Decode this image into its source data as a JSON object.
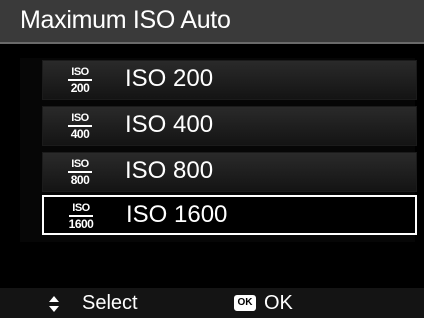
{
  "header": {
    "title": "Maximum ISO Auto"
  },
  "items": [
    {
      "icon_top": "ISO",
      "icon_value": "200",
      "label": "ISO 200",
      "selected": false
    },
    {
      "icon_top": "ISO",
      "icon_value": "400",
      "label": "ISO 400",
      "selected": false
    },
    {
      "icon_top": "ISO",
      "icon_value": "800",
      "label": "ISO 800",
      "selected": false
    },
    {
      "icon_top": "ISO",
      "icon_value": "1600",
      "label": "ISO 1600",
      "selected": true
    }
  ],
  "footer": {
    "select_icon": "up-down-arrows-icon",
    "select_label": "Select",
    "ok_icon_text": "OK",
    "ok_label": "OK"
  },
  "colors": {
    "background": "#000000",
    "title_bar": "#3a3a3a",
    "text": "#ffffff",
    "selection_border": "#ffffff"
  }
}
